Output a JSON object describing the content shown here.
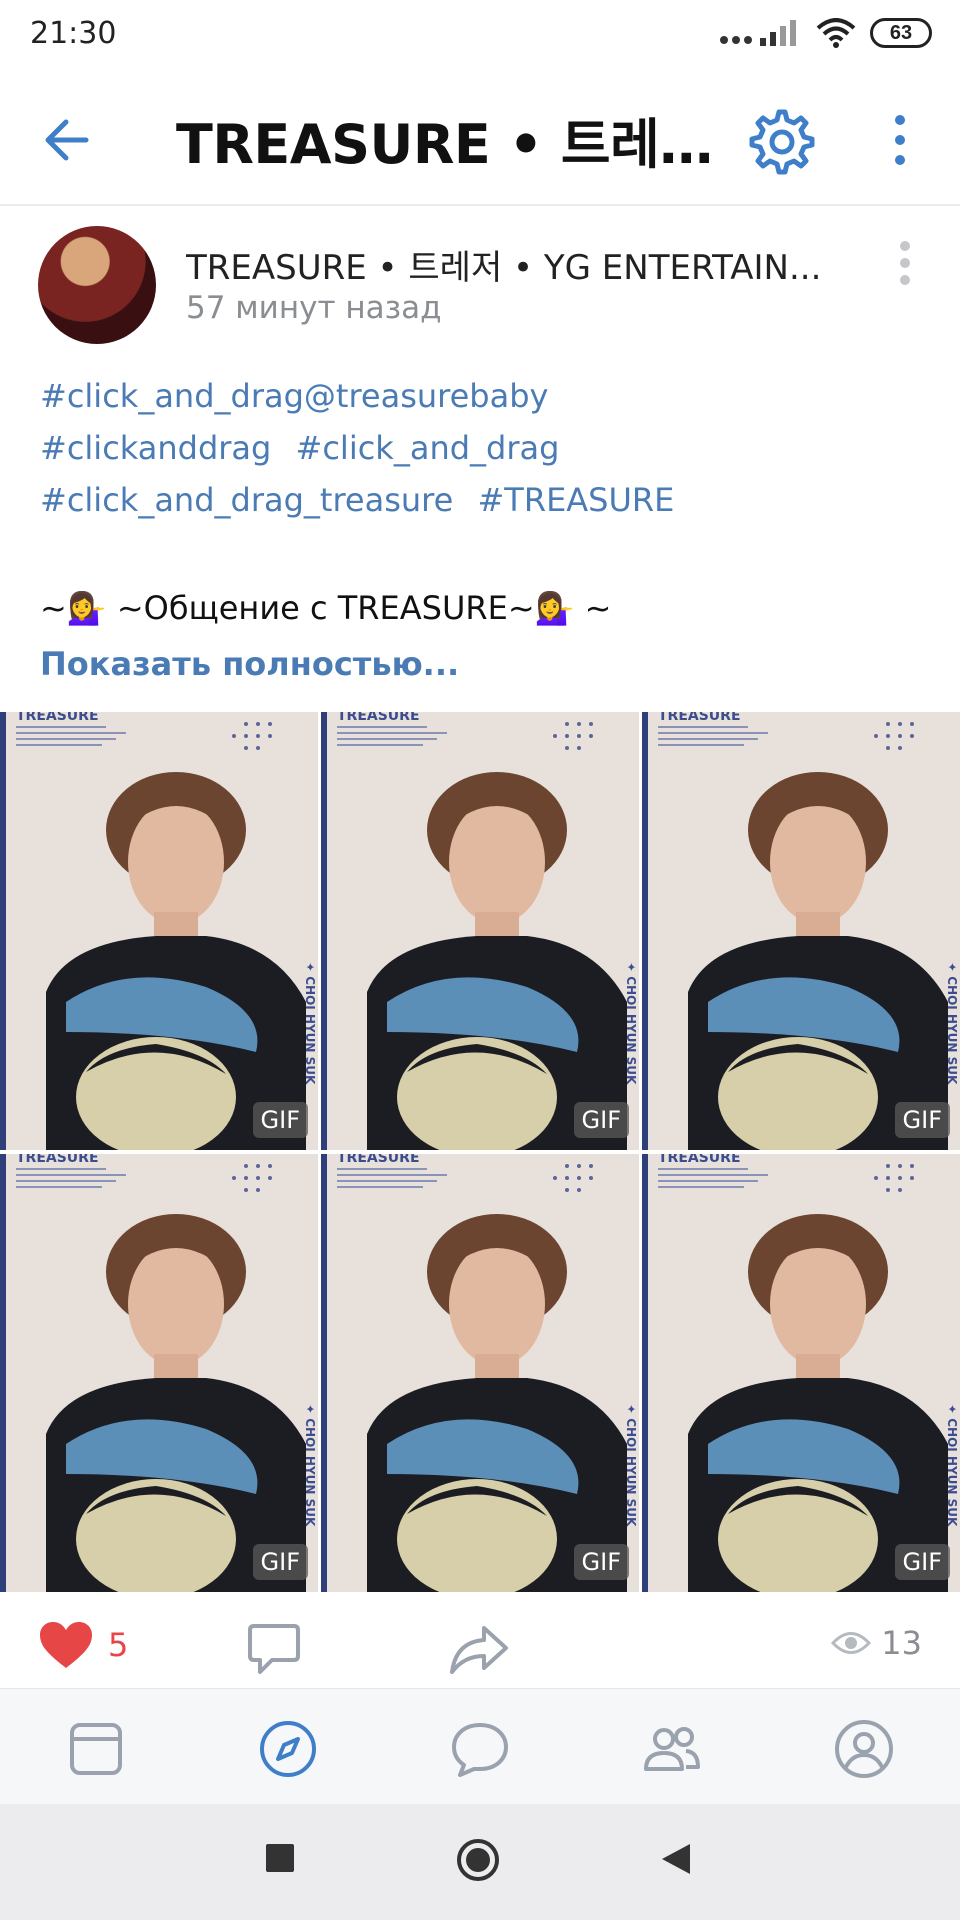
{
  "status_bar": {
    "time": "21:30",
    "battery": "63"
  },
  "header": {
    "title": "TREASURE • 트레저..."
  },
  "post": {
    "author": "TREASURE • 트레저 • YG ENTERTAIN...",
    "time": "57 минут назад",
    "hashtag_lines": [
      [
        "#click_and_drag@treasurebaby"
      ],
      [
        "#clickanddrag",
        "#click_and_drag"
      ],
      [
        "#click_and_drag_treasure",
        "#TREASURE"
      ]
    ],
    "body_text": "~💁‍♀️ ~Общение с TREASURE~💁‍♀️ ~",
    "show_more": "Показать полностью...",
    "media": [
      {
        "badge": "GIF"
      },
      {
        "badge": "GIF"
      },
      {
        "badge": "GIF"
      },
      {
        "badge": "GIF"
      },
      {
        "badge": "GIF"
      },
      {
        "badge": "GIF"
      }
    ],
    "media_overlay_text": {
      "logo": "TREASURE",
      "name": "✦ CHOI HYUN SUK"
    }
  },
  "actions": {
    "likes": "5",
    "views": "13"
  },
  "colors": {
    "accent": "#4a7bb4",
    "like": "#e64646",
    "muted": "#8a8d91"
  },
  "icons": {
    "header": [
      "back-arrow-icon",
      "settings-gear-icon",
      "more-vertical-icon"
    ],
    "actions": [
      "heart-icon",
      "comment-icon",
      "share-icon",
      "eye-icon"
    ],
    "nav": [
      "news-icon",
      "discover-icon",
      "messages-icon",
      "friends-icon",
      "profile-icon"
    ]
  }
}
